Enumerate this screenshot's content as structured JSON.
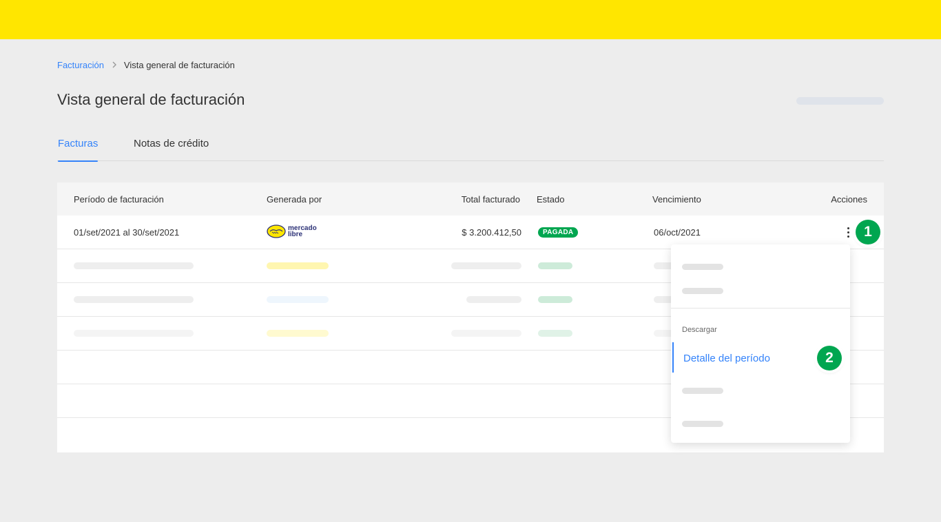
{
  "breadcrumb": {
    "parent": "Facturación",
    "current": "Vista general de facturación"
  },
  "page": {
    "title": "Vista general de facturación"
  },
  "tabs": [
    {
      "label": "Facturas",
      "active": true
    },
    {
      "label": "Notas de crédito",
      "active": false
    }
  ],
  "table": {
    "headers": {
      "period": "Período de facturación",
      "generated_by": "Generada por",
      "total": "Total facturado",
      "status": "Estado",
      "due": "Vencimiento",
      "actions": "Acciones"
    },
    "row": {
      "period": "01/set/2021 al 30/set/2021",
      "generated_by_logo_line1": "mercado",
      "generated_by_logo_line2": "libre",
      "total": "$ 3.200.412,50",
      "status": "PAGADA",
      "due": "06/oct/2021"
    }
  },
  "menu": {
    "section_label": "Descargar",
    "item_label": "Detalle del período"
  },
  "steps": {
    "one": "1",
    "two": "2"
  },
  "colors": {
    "brand_yellow": "#ffe600",
    "accent_blue": "#3483fa",
    "status_green": "#00a650",
    "logo_navy": "#2d3277"
  },
  "icons": {
    "separator": "chevron-right-icon",
    "actions": "kebab-menu-icon",
    "logo": "mercadolibre-handshake-logo"
  }
}
